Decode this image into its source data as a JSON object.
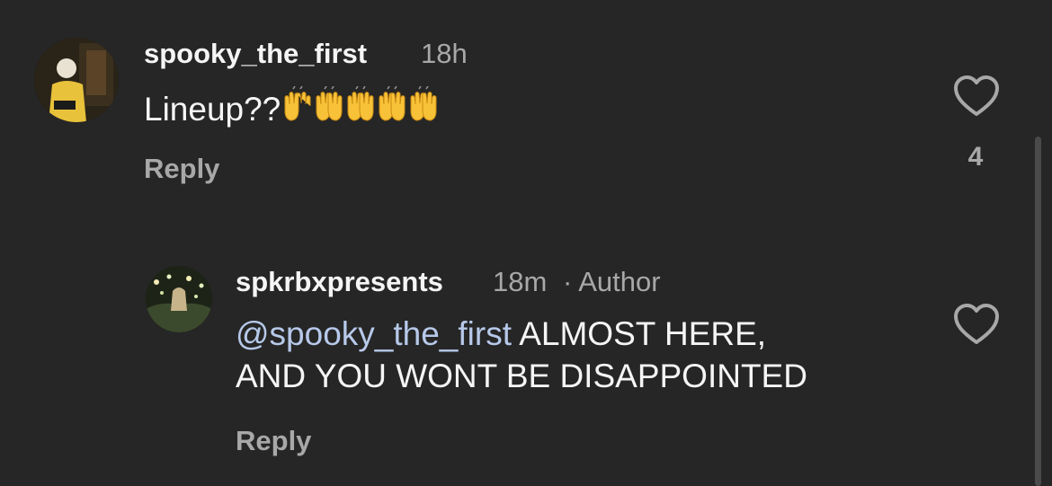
{
  "comments": [
    {
      "username": "spooky_the_first",
      "time": "18h",
      "text": "Lineup??",
      "emoji": "raising-hands x5",
      "reply_label": "Reply",
      "like_count": "4"
    },
    {
      "username": "spkrbxpresents",
      "time": "18m",
      "author_tag": "· Author",
      "mention": "@spooky_the_first",
      "text_line1": " ALMOST HERE,",
      "text_line2": "AND YOU WONT BE DISAPPOINTED",
      "reply_label": "Reply"
    }
  ],
  "colors": {
    "background": "#262626",
    "primary_text": "#f5f5f5",
    "secondary_text": "#a8a8a8",
    "mention": "#b7c9ea",
    "emoji": "#f7c238"
  },
  "icons": [
    "heart-outline-icon",
    "raising-hands-emoji"
  ]
}
